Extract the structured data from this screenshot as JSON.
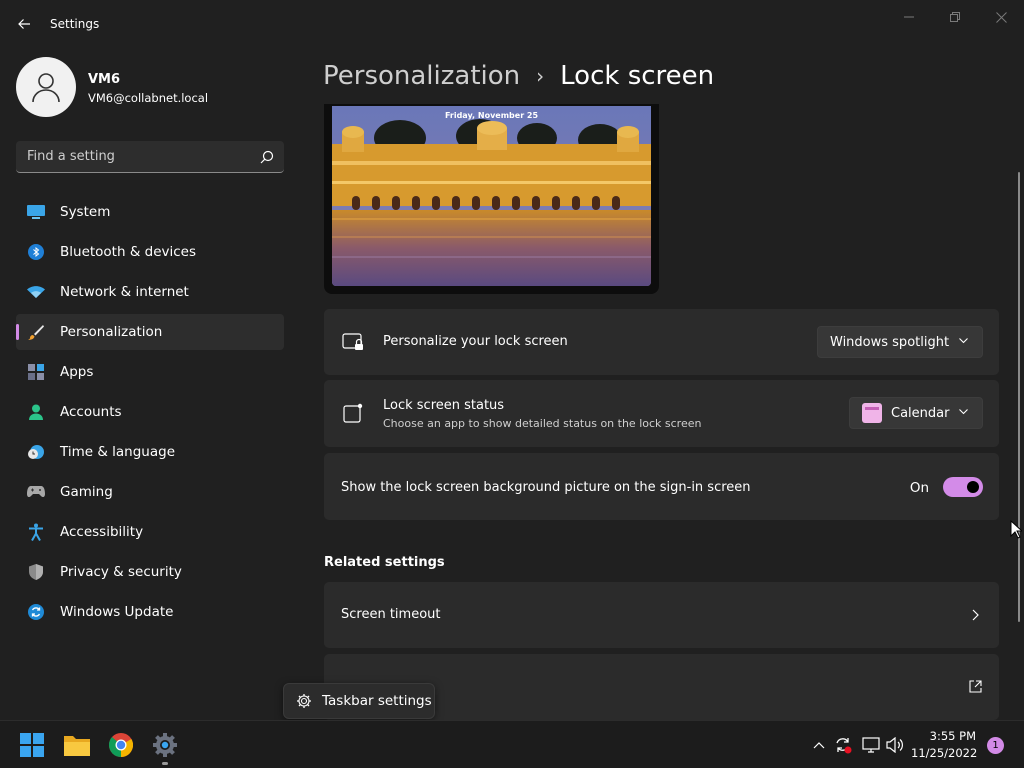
{
  "window": {
    "title": "Settings"
  },
  "profile": {
    "name": "VM6",
    "email": "VM6@collabnet.local"
  },
  "search": {
    "placeholder": "Find a setting"
  },
  "sidebar": {
    "items": [
      {
        "label": "System",
        "icon": "system-icon"
      },
      {
        "label": "Bluetooth & devices",
        "icon": "bluetooth-icon"
      },
      {
        "label": "Network & internet",
        "icon": "wifi-icon"
      },
      {
        "label": "Personalization",
        "icon": "brush-icon",
        "active": true
      },
      {
        "label": "Apps",
        "icon": "apps-icon"
      },
      {
        "label": "Accounts",
        "icon": "accounts-icon"
      },
      {
        "label": "Time & language",
        "icon": "clock-globe-icon"
      },
      {
        "label": "Gaming",
        "icon": "gamepad-icon"
      },
      {
        "label": "Accessibility",
        "icon": "accessibility-icon"
      },
      {
        "label": "Privacy & security",
        "icon": "shield-icon"
      },
      {
        "label": "Windows Update",
        "icon": "update-icon"
      }
    ]
  },
  "breadcrumb": {
    "parent": "Personalization",
    "separator": "›",
    "current": "Lock screen"
  },
  "preview": {
    "date": "Friday, November 25"
  },
  "settings": {
    "personalize": {
      "title": "Personalize your lock screen",
      "value": "Windows spotlight"
    },
    "status": {
      "title": "Lock screen status",
      "description": "Choose an app to show detailed status on the lock screen",
      "value": "Calendar"
    },
    "signin_background": {
      "title": "Show the lock screen background picture on the sign-in screen",
      "state_label": "On",
      "enabled": true
    }
  },
  "related": {
    "heading": "Related settings",
    "items": [
      {
        "label": "Screen timeout"
      }
    ]
  },
  "tooltip": {
    "label": "Taskbar settings"
  },
  "taskbar": {
    "time": "3:55 PM",
    "date": "11/25/2022",
    "notification_count": "1"
  },
  "colors": {
    "accent": "#d28ae6",
    "background": "#202020",
    "card": "#2b2b2b"
  }
}
